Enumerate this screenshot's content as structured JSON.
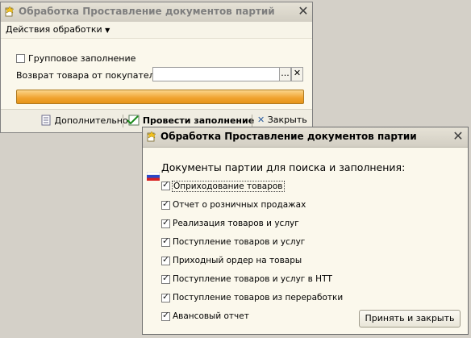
{
  "window1": {
    "title": "Обработка  Проставление документов партий",
    "menu_label": "Действия обработки",
    "group_fill_label": "Групповое заполнение",
    "return_label": "Возврат товара от покупателя:",
    "return_value": "",
    "select_button": "...",
    "clear_button": "✕",
    "progress_percent": 100,
    "footer": {
      "additional": "Дополнительно",
      "run_fill": "Провести заполнение",
      "close": "Закрыть"
    }
  },
  "window2": {
    "title": "Обработка  Проставление документов партии",
    "heading": "Документы партии для поиска и заполнения:",
    "items": [
      {
        "label": "Оприходование товаров",
        "checked": true
      },
      {
        "label": "Отчет о розничных продажах",
        "checked": true
      },
      {
        "label": "Реализация товаров и услуг",
        "checked": true
      },
      {
        "label": "Поступление товаров и услуг",
        "checked": true
      },
      {
        "label": "Приходный ордер на товары",
        "checked": true
      },
      {
        "label": "Поступление товаров и услуг в НТТ",
        "checked": true
      },
      {
        "label": "Поступление товаров из переработки",
        "checked": true
      },
      {
        "label": "Авансовый отчет",
        "checked": true
      }
    ],
    "accept_button": "Принять и закрыть"
  },
  "colors": {
    "progress": "#f0a22e",
    "window_bg": "#fbf8ec",
    "desktop": "#d4d0c8"
  }
}
